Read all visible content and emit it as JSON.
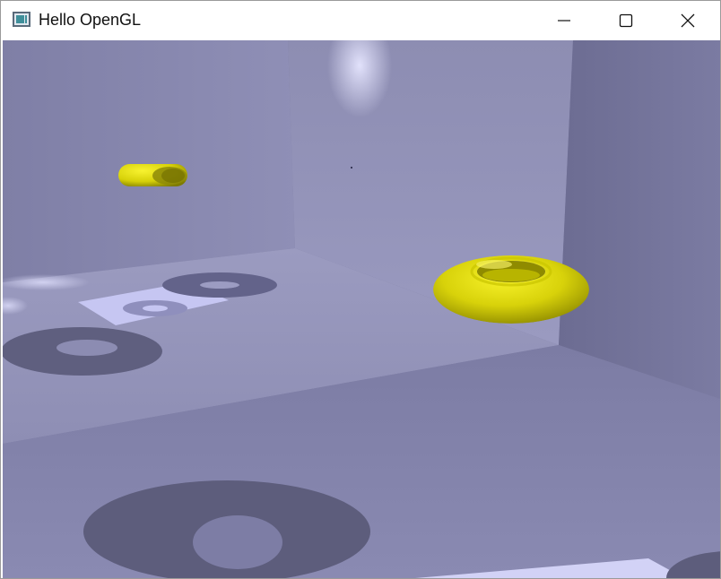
{
  "window": {
    "title": "Hello OpenGL",
    "app_icon": "opengl-app-icon",
    "controls": {
      "minimize": "minimize-icon",
      "maximize": "maximize-icon",
      "close": "close-icon"
    }
  },
  "scene": {
    "objects": [
      "small-yellow-torus",
      "large-yellow-torus"
    ],
    "colors": {
      "torus": "#e8e40a",
      "torus_shadow": "#8c8c14",
      "room": "#8a8ab0",
      "floor_shadow": "#5a5a78",
      "light_patch": "#c8c8f4"
    }
  }
}
